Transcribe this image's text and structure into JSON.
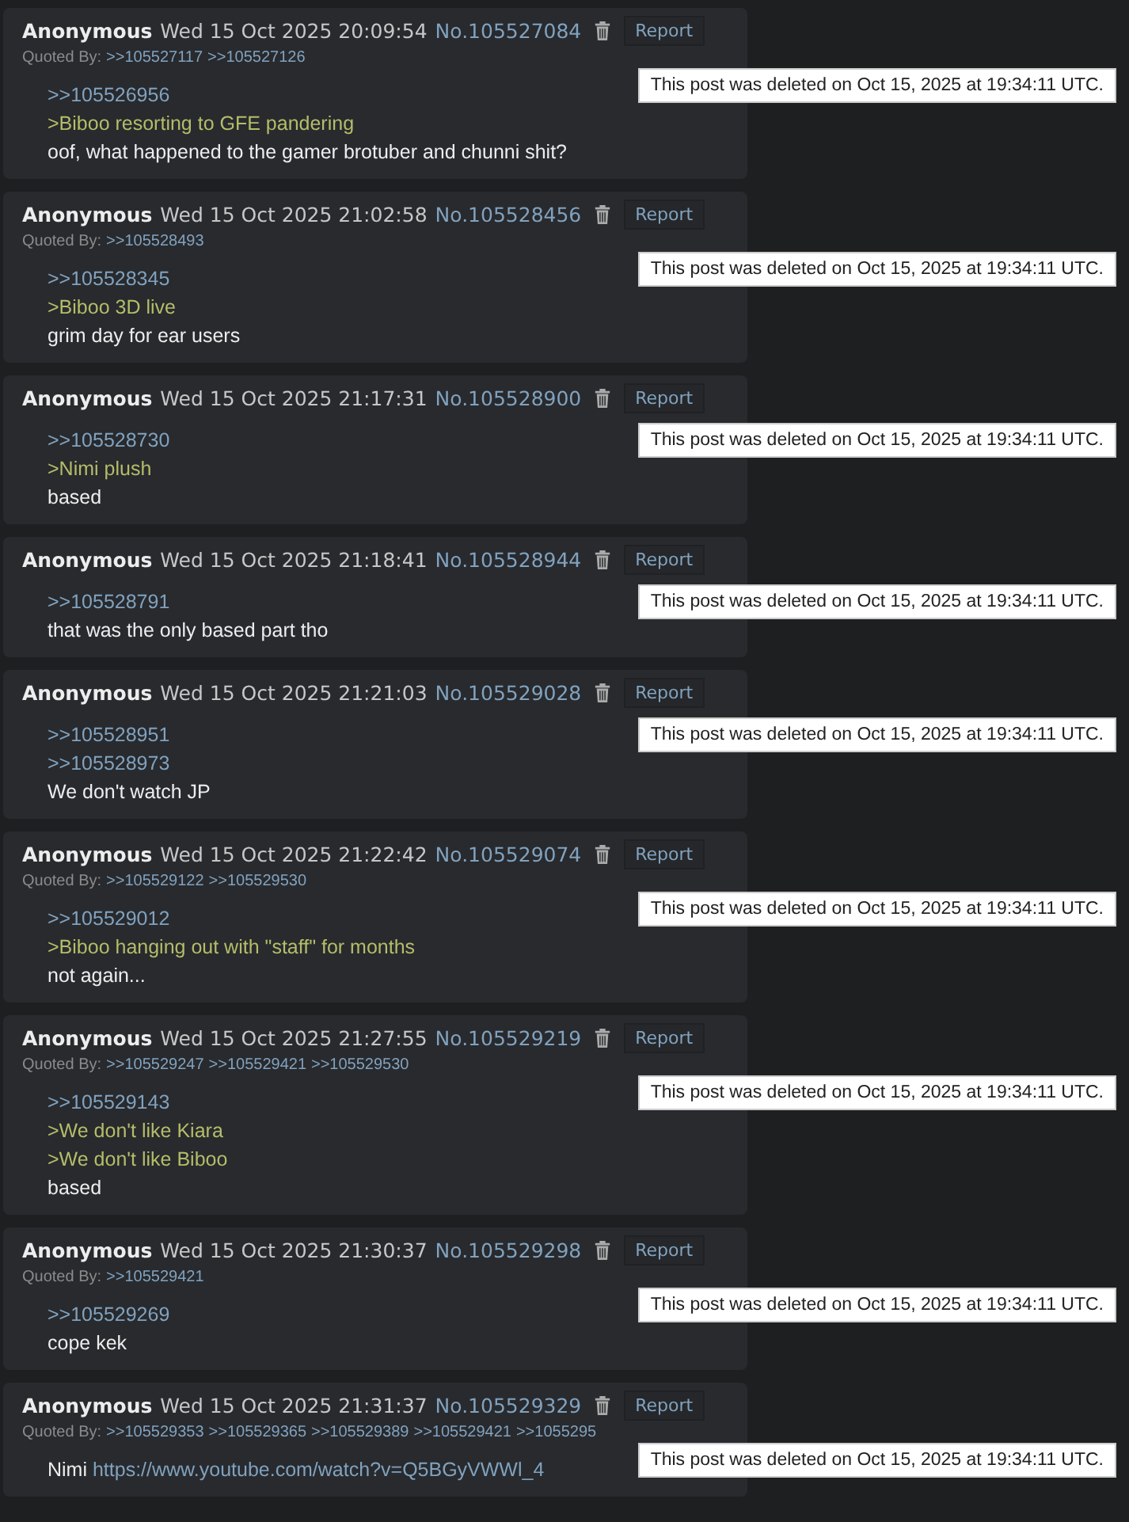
{
  "posts": [
    {
      "name": "Anonymous",
      "date": "Wed 15 Oct 2025 20:09:54",
      "number": "No.105527084",
      "report": "Report",
      "quoted_label": "Quoted By:",
      "quoted_by": [
        ">>105527117",
        ">>105527126"
      ],
      "body": [
        {
          "kind": "quotelink",
          "text": ">>105526956"
        },
        {
          "kind": "greentext",
          "text": ">Biboo resorting to GFE pandering"
        },
        {
          "kind": "text",
          "text": "oof, what happened to the gamer brotuber and chunni shit?"
        }
      ],
      "tooltip": "This post was deleted on Oct 15, 2025 at 19:34:11 UTC."
    },
    {
      "name": "Anonymous",
      "date": "Wed 15 Oct 2025 21:02:58",
      "number": "No.105528456",
      "report": "Report",
      "quoted_label": "Quoted By:",
      "quoted_by": [
        ">>105528493"
      ],
      "body": [
        {
          "kind": "quotelink",
          "text": ">>105528345"
        },
        {
          "kind": "greentext",
          "text": ">Biboo 3D live"
        },
        {
          "kind": "text",
          "text": "grim day for ear users"
        }
      ],
      "tooltip": "This post was deleted on Oct 15, 2025 at 19:34:11 UTC."
    },
    {
      "name": "Anonymous",
      "date": "Wed 15 Oct 2025 21:17:31",
      "number": "No.105528900",
      "report": "Report",
      "body": [
        {
          "kind": "quotelink",
          "text": ">>105528730"
        },
        {
          "kind": "greentext",
          "text": ">Nimi plush"
        },
        {
          "kind": "text",
          "text": "based"
        }
      ],
      "tooltip": "This post was deleted on Oct 15, 2025 at 19:34:11 UTC."
    },
    {
      "name": "Anonymous",
      "date": "Wed 15 Oct 2025 21:18:41",
      "number": "No.105528944",
      "report": "Report",
      "body": [
        {
          "kind": "quotelink",
          "text": ">>105528791"
        },
        {
          "kind": "text",
          "text": "that was the only based part tho"
        }
      ],
      "tooltip": "This post was deleted on Oct 15, 2025 at 19:34:11 UTC."
    },
    {
      "name": "Anonymous",
      "date": "Wed 15 Oct 2025 21:21:03",
      "number": "No.105529028",
      "report": "Report",
      "body": [
        {
          "kind": "quotelink",
          "text": ">>105528951"
        },
        {
          "kind": "quotelink",
          "text": ">>105528973"
        },
        {
          "kind": "text",
          "text": "We don't watch JP"
        }
      ],
      "tooltip": "This post was deleted on Oct 15, 2025 at 19:34:11 UTC."
    },
    {
      "name": "Anonymous",
      "date": "Wed 15 Oct 2025 21:22:42",
      "number": "No.105529074",
      "report": "Report",
      "quoted_label": "Quoted By:",
      "quoted_by": [
        ">>105529122",
        ">>105529530"
      ],
      "body": [
        {
          "kind": "quotelink",
          "text": ">>105529012"
        },
        {
          "kind": "greentext",
          "text": ">Biboo hanging out with \"staff\" for months"
        },
        {
          "kind": "text",
          "text": "not again..."
        }
      ],
      "tooltip": "This post was deleted on Oct 15, 2025 at 19:34:11 UTC."
    },
    {
      "name": "Anonymous",
      "date": "Wed 15 Oct 2025 21:27:55",
      "number": "No.105529219",
      "report": "Report",
      "quoted_label": "Quoted By:",
      "quoted_by": [
        ">>105529247",
        ">>105529421",
        ">>105529530"
      ],
      "body": [
        {
          "kind": "quotelink",
          "text": ">>105529143"
        },
        {
          "kind": "greentext",
          "text": ">We don't like Kiara"
        },
        {
          "kind": "greentext",
          "text": ">We don't like Biboo"
        },
        {
          "kind": "text",
          "text": "based"
        }
      ],
      "tooltip": "This post was deleted on Oct 15, 2025 at 19:34:11 UTC."
    },
    {
      "name": "Anonymous",
      "date": "Wed 15 Oct 2025 21:30:37",
      "number": "No.105529298",
      "report": "Report",
      "quoted_label": "Quoted By:",
      "quoted_by": [
        ">>105529421"
      ],
      "body": [
        {
          "kind": "quotelink",
          "text": ">>105529269"
        },
        {
          "kind": "text",
          "text": "cope kek"
        }
      ],
      "tooltip": "This post was deleted on Oct 15, 2025 at 19:34:11 UTC."
    },
    {
      "name": "Anonymous",
      "date": "Wed 15 Oct 2025 21:31:37",
      "number": "No.105529329",
      "report": "Report",
      "quoted_label": "Quoted By:",
      "quoted_by": [
        ">>105529353",
        ">>105529365",
        ">>105529389",
        ">>105529421",
        ">>1055295"
      ],
      "body": [
        {
          "kind": "text_link",
          "text": "Nimi",
          "link": "https://www.youtube.com/watch?v=Q5BGyVWWl_4"
        }
      ],
      "tooltip": "This post was deleted on Oct 15, 2025 at 19:34:11 UTC."
    }
  ]
}
